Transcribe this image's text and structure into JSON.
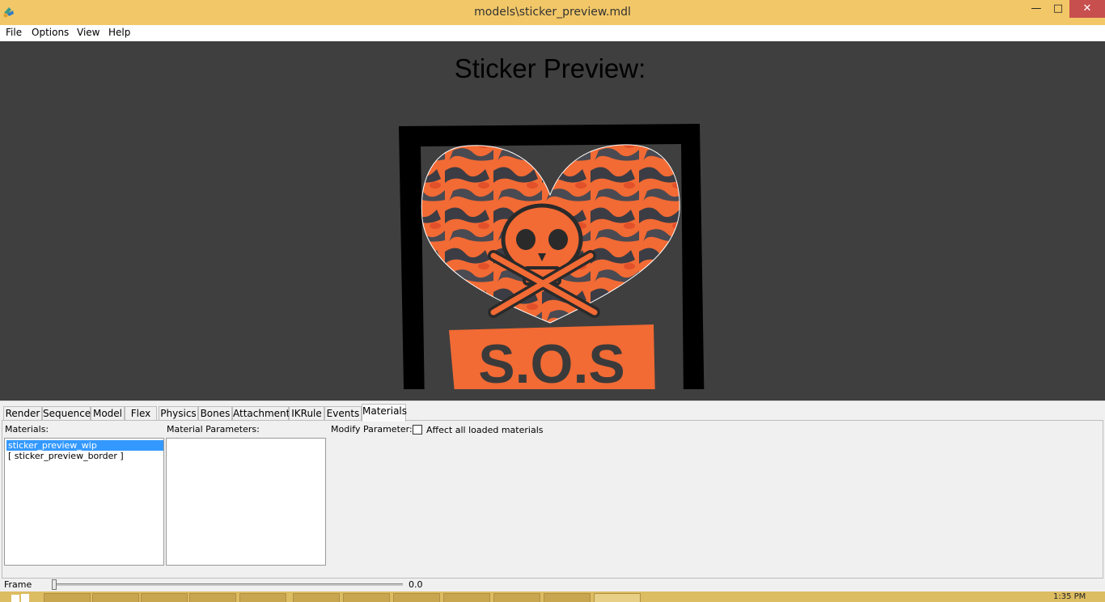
{
  "window": {
    "title": "models\\sticker_preview.mdl",
    "minimize_glyph": "—",
    "maximize_glyph": "□",
    "close_glyph": "✕"
  },
  "menu": [
    "File",
    "Options",
    "View",
    "Help"
  ],
  "viewport": {
    "title": "Sticker Preview:",
    "sticker_text": "S.O.S"
  },
  "tabs": [
    "Render",
    "Sequence",
    "Model",
    "Flex",
    "Physics",
    "Bones",
    "Attachments",
    "IKRule",
    "Events",
    "Materials"
  ],
  "active_tab": "Materials",
  "materials_panel": {
    "materials_label": "Materials:",
    "materials": [
      "sticker_preview_wip",
      "[ sticker_preview_border ]"
    ],
    "selected_index": 0,
    "params_label": "Material Parameters:",
    "modify_label": "Modify Parameter:",
    "affect_all_label": "Affect all loaded materials",
    "affect_all_checked": false
  },
  "frame": {
    "label": "Frame",
    "value": "0.0",
    "slider_fraction": 0
  },
  "taskbar": {
    "clock": "1:35 PM"
  },
  "colors": {
    "titlebar": "#f2c767",
    "viewport_bg": "#3f3f3f",
    "close_button": "#c7504f",
    "selection": "#3399ff",
    "sticker_orange": "#f26a34",
    "taskbar": "#ddbd62"
  }
}
